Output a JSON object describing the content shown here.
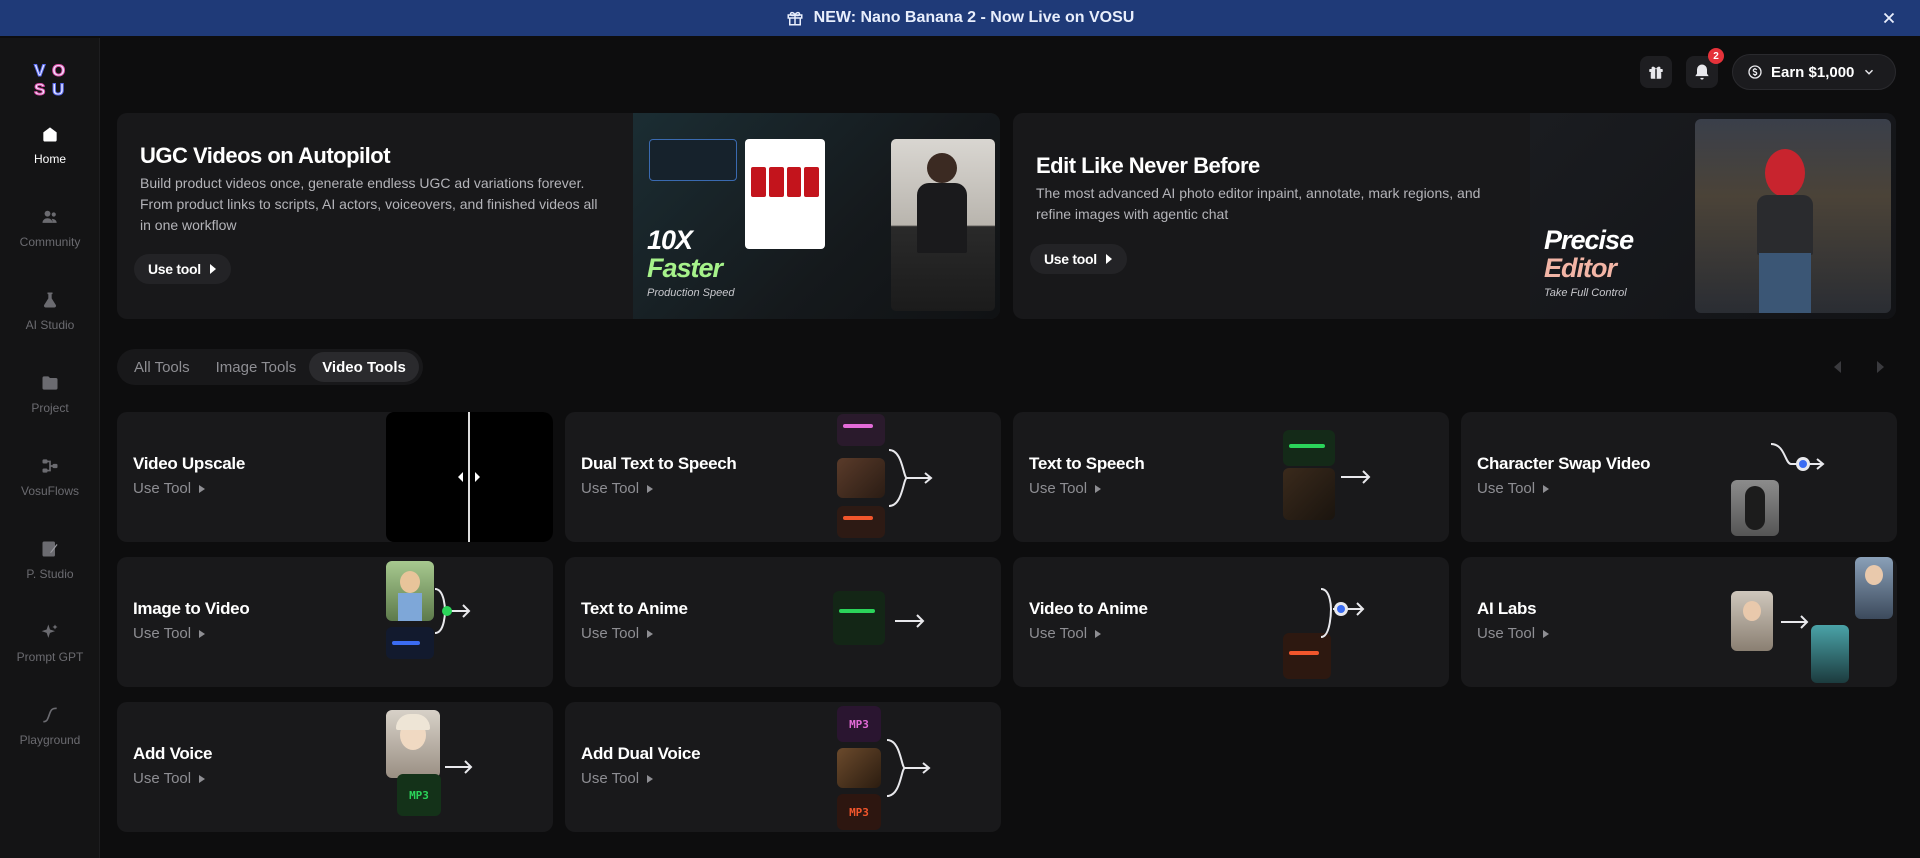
{
  "banner": {
    "text": "NEW: Nano Banana 2 - Now Live on VOSU"
  },
  "sidebar": {
    "items": [
      {
        "label": "Home",
        "icon": "home-icon"
      },
      {
        "label": "Community",
        "icon": "users-icon"
      },
      {
        "label": "AI Studio",
        "icon": "flask-icon"
      },
      {
        "label": "Project",
        "icon": "folder-icon"
      },
      {
        "label": "VosuFlows",
        "icon": "flow-icon"
      },
      {
        "label": "P. Studio",
        "icon": "palette-icon"
      },
      {
        "label": "Prompt GPT",
        "icon": "sparkle-icon"
      },
      {
        "label": "Playground",
        "icon": "curve-icon"
      }
    ]
  },
  "header": {
    "notifications": "2",
    "earn": "Earn $1,000"
  },
  "hero": [
    {
      "title": "UGC Videos on Autopilot",
      "desc": "Build product videos once, generate endless UGC ad variations forever. From product links to scripts, AI actors, voiceovers, and finished videos all in one workflow",
      "button": "Use tool",
      "big_a": "10X",
      "big_b": "Faster",
      "caption": "Production Speed"
    },
    {
      "title": "Edit Like Never Before",
      "desc": "The most advanced AI photo editor inpaint, annotate, mark regions, and refine images with agentic chat",
      "button": "Use tool",
      "big_a": "Precise",
      "big_b": "Editor",
      "caption": "Take Full Control"
    }
  ],
  "tabs": [
    "All Tools",
    "Image Tools",
    "Video Tools"
  ],
  "active_tab": "Video Tools",
  "tools": [
    {
      "title": "Video Upscale",
      "sub": "Use Tool"
    },
    {
      "title": "Dual Text to Speech",
      "sub": "Use Tool"
    },
    {
      "title": "Text to Speech",
      "sub": "Use Tool"
    },
    {
      "title": "Character Swap Video",
      "sub": "Use Tool"
    },
    {
      "title": "Image to Video",
      "sub": "Use Tool"
    },
    {
      "title": "Text to Anime",
      "sub": "Use Tool"
    },
    {
      "title": "Video to Anime",
      "sub": "Use Tool"
    },
    {
      "title": "AI Labs",
      "sub": "Use Tool"
    },
    {
      "title": "Add Voice",
      "sub": "Use Tool"
    },
    {
      "title": "Add Dual Voice",
      "sub": "Use Tool"
    }
  ],
  "mp3_label": "MP3",
  "colors": {
    "banner": "#1f3a78",
    "accent_green": "#2bd45a",
    "accent_pink": "#e36bd8",
    "accent_orange": "#f2562c",
    "accent_blue": "#3b6cf2",
    "badge_red": "#e5323a"
  }
}
